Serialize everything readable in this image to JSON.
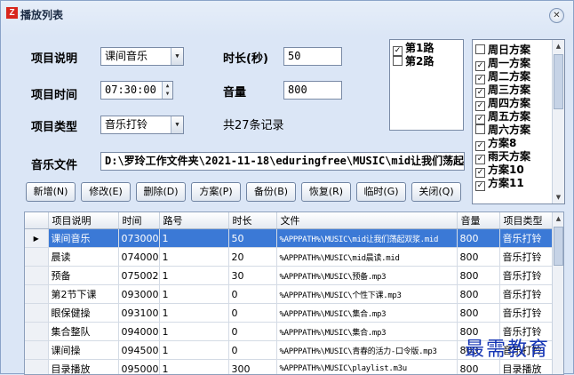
{
  "window": {
    "title": "播放列表",
    "app_icon": "Z",
    "close_symbol": "✕"
  },
  "form": {
    "desc_label": "项目说明",
    "desc_value": "课间音乐",
    "duration_label": "时长(秒)",
    "duration_value": "50",
    "time_label": "项目时间",
    "time_value": "07:30:00",
    "volume_label": "音量",
    "volume_value": "800",
    "type_label": "项目类型",
    "type_value": "音乐打铃",
    "record_count": "共27条记录",
    "file_label": "音乐文件",
    "file_value": "D:\\罗玲工作文件夹\\2021-11-18\\eduringfree\\MUSIC\\mid让我们荡起"
  },
  "routes": [
    {
      "label": "第1路",
      "checked": true
    },
    {
      "label": "第2路",
      "checked": false
    }
  ],
  "plans": [
    {
      "label": "周日方案",
      "checked": false
    },
    {
      "label": "周一方案",
      "checked": true
    },
    {
      "label": "周二方案",
      "checked": true
    },
    {
      "label": "周三方案",
      "checked": true
    },
    {
      "label": "周四方案",
      "checked": true
    },
    {
      "label": "周五方案",
      "checked": true
    },
    {
      "label": "周六方案",
      "checked": false
    },
    {
      "label": "方案8",
      "checked": true
    },
    {
      "label": "雨天方案",
      "checked": true
    },
    {
      "label": "方案10",
      "checked": true
    },
    {
      "label": "方案11",
      "checked": true
    }
  ],
  "buttons": {
    "new": "新增(N)",
    "edit": "修改(E)",
    "delete": "删除(D)",
    "plan": "方案(P)",
    "backup": "备份(B)",
    "restore": "恢复(R)",
    "temp": "临时(G)",
    "close": "关闭(Q)"
  },
  "table": {
    "headers": [
      "项目说明",
      "时间",
      "路号",
      "时长",
      "文件",
      "音量",
      "项目类型"
    ],
    "rows": [
      [
        "课间音乐",
        "073000",
        "1",
        "50",
        "%APPPATH%\\MUSIC\\mid让我们荡起双浆.mid",
        "800",
        "音乐打铃"
      ],
      [
        "晨读",
        "074000",
        "1",
        "20",
        "%APPPATH%\\MUSIC\\mid晨读.mid",
        "800",
        "音乐打铃"
      ],
      [
        "预备",
        "075002",
        "1",
        "30",
        "%APPPATH%\\MUSIC\\预备.mp3",
        "800",
        "音乐打铃"
      ],
      [
        "第2节下课",
        "093000",
        "1",
        "0",
        "%APPPATH%\\MUSIC\\个性下课.mp3",
        "800",
        "音乐打铃"
      ],
      [
        "眼保健操",
        "093100",
        "1",
        "0",
        "%APPPATH%\\MUSIC\\集合.mp3",
        "800",
        "音乐打铃"
      ],
      [
        "集合整队",
        "094000",
        "1",
        "0",
        "%APPPATH%\\MUSIC\\集合.mp3",
        "800",
        "音乐打铃"
      ],
      [
        "课间操",
        "094500",
        "1",
        "0",
        "%APPPATH%\\MUSIC\\青春的活力-口令版.mp3",
        "800",
        "音乐打铃"
      ],
      [
        "目录播放",
        "095000",
        "1",
        "300",
        "%APPPATH%\\MUSIC\\playlist.m3u",
        "800",
        "目录播放"
      ]
    ],
    "selected_row": 0,
    "row_indicator": "▶"
  },
  "watermark": "最需教育",
  "icons": {
    "combo": "▼",
    "spin_up": "▲",
    "spin_down": "▼",
    "scroll_up": "▲",
    "scroll_down": "▼",
    "check": "✓"
  }
}
